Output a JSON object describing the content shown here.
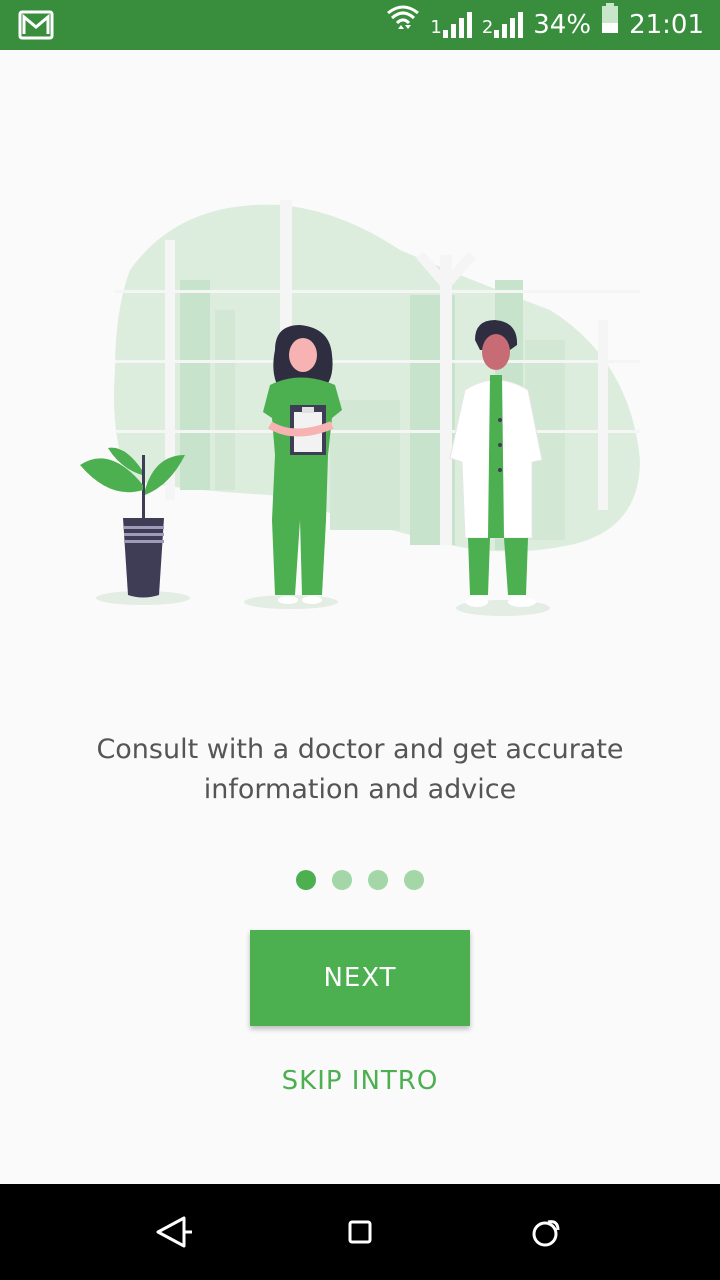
{
  "status_bar": {
    "battery_text": "34%",
    "time": "21:01",
    "sim1_label": "1",
    "sim2_label": "2"
  },
  "onboarding": {
    "caption": "Consult with a doctor and get accurate information and advice",
    "page_count": 4,
    "active_page": 1,
    "next_label": "NEXT",
    "skip_label": "SKIP INTRO"
  },
  "navigation": {
    "back_icon": "back-triangle-icon",
    "home_icon": "square-home-icon",
    "recents_icon": "circle-recents-icon"
  },
  "colors": {
    "primary": "#4caf50",
    "primary_dark": "#388e3c",
    "dot_inactive": "#a5d6a7"
  }
}
